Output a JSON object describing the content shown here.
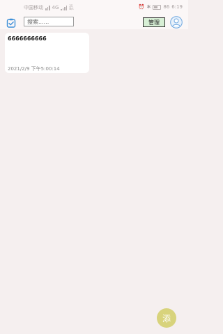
{
  "status_bar": {
    "carrier": "中国移动",
    "network_type": "4G",
    "net_speed_top": "25",
    "net_speed_bottom": "B/s",
    "battery": "86",
    "time": "6:19"
  },
  "header": {
    "search_placeholder": "搜索......",
    "manage_label": "管理"
  },
  "notes": [
    {
      "title": "6666666666",
      "date": "2021/2/9 下午5:00:14"
    }
  ],
  "fab": {
    "add_label": "添"
  },
  "colors": {
    "background": "#f5efef",
    "card": "#ffffff",
    "manage_button": "#d7efd5",
    "fab": "#d8d37c",
    "accent_icon": "#3d8fd8"
  },
  "icons": {
    "logo": "clipboard-check-icon",
    "avatar": "user-avatar-icon"
  }
}
